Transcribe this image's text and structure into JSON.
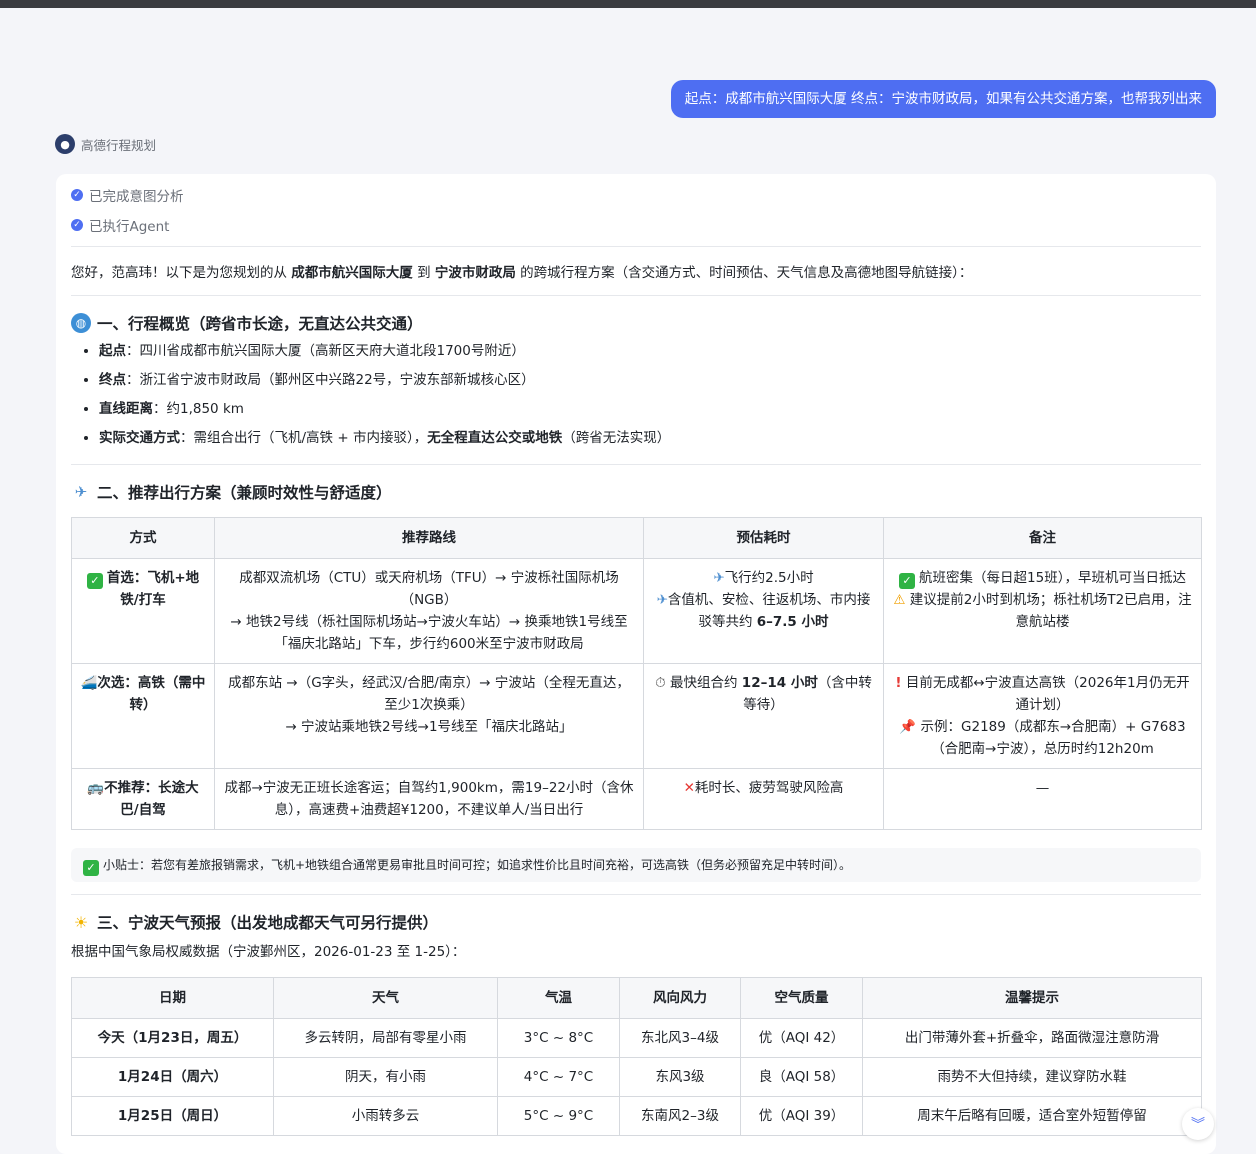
{
  "user_message": "起点：成都市航兴国际大厦 终点：宁波市财政局，如果有公共交通方案，也帮我列出来",
  "agent": {
    "name": "高德行程规划"
  },
  "steps": [
    "已完成意图分析",
    "已执行Agent"
  ],
  "intro": {
    "p1": "您好，范高玮！以下是为您规划的从 ",
    "origin": "成都市航兴国际大厦",
    "p2": " 到 ",
    "dest": "宁波市财政局",
    "p3": " 的跨城行程方案（含交通方式、时间预估、天气信息及高德地图导航链接）："
  },
  "section1": {
    "title": "一、行程概览（跨省市长途，无直达公共交通）",
    "items": [
      {
        "label": "起点",
        "text": "：四川省成都市航兴国际大厦（高新区天府大道北段1700号附近）"
      },
      {
        "label": "终点",
        "text": "：浙江省宁波市财政局（鄞州区中兴路22号，宁波东部新城核心区）"
      },
      {
        "label": "直线距离",
        "text": "：约1,850 km"
      },
      {
        "label": "实际交通方式",
        "text": "：需组合出行（飞机/高铁 + 市内接驳），",
        "bold2": "无全程直达公交或地铁",
        "text2": "（跨省无法实现）"
      }
    ]
  },
  "section2": {
    "title": "二、推荐出行方案（兼顾时效性与舒适度）",
    "headers": [
      "方式",
      "推荐路线",
      "预估耗时",
      "备注"
    ],
    "rows": [
      {
        "mode": "首选：飞机+地铁/打车",
        "route": [
          "成都双流机场（CTU）或天府机场（TFU）→ 宁波栎社国际机场（NGB）",
          "→ 地铁2号线（栎社国际机场站→宁波火车站）→ 换乘地铁1号线至「福庆北路站」下车，步行约600米至宁波市财政局"
        ],
        "time": [
          "飞行约2.5小时",
          "含值机、安检、往返机场、市内接驳等共约 ",
          "6–7.5 小时"
        ],
        "note": [
          "航班密集（每日超15班），早班机可当日抵达",
          "建议提前2小时到机场；栎社机场T2已启用，注意航站楼"
        ]
      },
      {
        "mode": "次选：高铁（需中转）",
        "route": [
          "成都东站 →（G字头，经武汉/合肥/南京）→ 宁波站（全程无直达，至少1次换乘）",
          "→ 宁波站乘地铁2号线→1号线至「福庆北路站」"
        ],
        "time": [
          "最快组合约 ",
          "12–14 小时",
          "（含中转等待）"
        ],
        "note": [
          "目前无成都↔宁波直达高铁（2026年1月仍无开通计划）",
          "示例：G2189（成都东→合肥南）+ G7683（合肥南→宁波），总历时约12h20m"
        ]
      },
      {
        "mode": "不推荐：长途大巴/自驾",
        "route": [
          "成都→宁波无正班长途客运；自驾约1,900km，需19–22小时（含休息），高速费+油费超¥1200，不建议单人/当日出行"
        ],
        "time": [
          "耗时长、疲劳驾驶风险高"
        ],
        "note": [
          "—"
        ]
      }
    ],
    "tip": "小贴士：若您有差旅报销需求，飞机+地铁组合通常更易审批且时间可控；如追求性价比且时间充裕，可选高铁（但务必预留充足中转时间）。"
  },
  "section3": {
    "title": "三、宁波天气预报（出发地成都天气可另行提供）",
    "subtitle": "根据中国气象局权威数据（宁波鄞州区，2026-01-23 至 1-25）：",
    "headers": [
      "日期",
      "天气",
      "气温",
      "风向风力",
      "空气质量",
      "温馨提示"
    ],
    "rows": [
      [
        "今天（1月23日，周五）",
        "多云转阴，局部有零星小雨",
        "3°C ~ 8°C",
        "东北风3–4级",
        "优（AQI 42）",
        "出门带薄外套+折叠伞，路面微湿注意防滑"
      ],
      [
        "1月24日（周六）",
        "阴天，有小雨",
        "4°C ~ 7°C",
        "东风3级",
        "良（AQI 58）",
        "雨势不大但持续，建议穿防水鞋"
      ],
      [
        "1月25日（周日）",
        "小雨转多云",
        "5°C ~ 9°C",
        "东南风2–3级",
        "优（AQI 39）",
        "周末午后略有回暖，适合室外短暂停留"
      ]
    ]
  }
}
